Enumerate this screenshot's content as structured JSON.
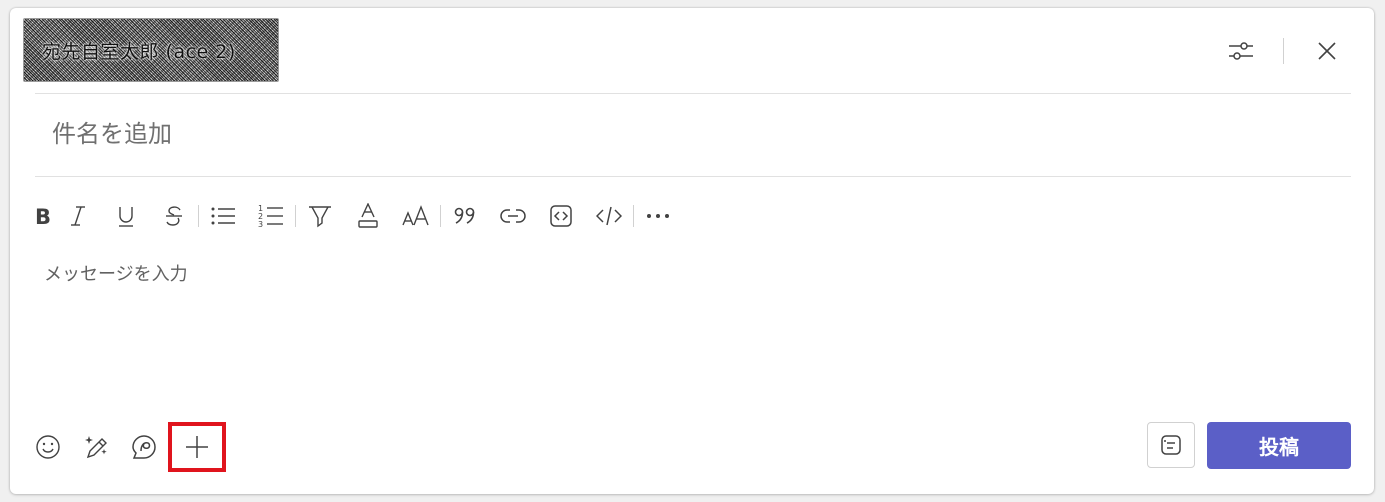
{
  "header": {
    "recipient": "宛先自室太郎 (ace 2)",
    "options_icon": "sliders-icon",
    "close_icon": "close-icon"
  },
  "subject": {
    "placeholder": "件名を追加"
  },
  "toolbar": {
    "items": [
      {
        "name": "bold",
        "icon": "bold-icon"
      },
      {
        "name": "italic",
        "icon": "italic-icon"
      },
      {
        "name": "underline",
        "icon": "underline-icon"
      },
      {
        "name": "strikethrough",
        "icon": "strikethrough-icon"
      },
      {
        "name": "bulleted-list",
        "icon": "bulleted-list-icon"
      },
      {
        "name": "numbered-list",
        "icon": "numbered-list-icon"
      },
      {
        "name": "highlight",
        "icon": "highlighter-icon"
      },
      {
        "name": "font-color",
        "icon": "font-color-icon"
      },
      {
        "name": "font-size",
        "icon": "font-size-icon"
      },
      {
        "name": "quote",
        "icon": "quote-icon"
      },
      {
        "name": "link",
        "icon": "link-icon"
      },
      {
        "name": "code-snippet",
        "icon": "code-snippet-icon"
      },
      {
        "name": "inline-code",
        "icon": "inline-code-icon"
      },
      {
        "name": "more",
        "icon": "more-icon"
      }
    ]
  },
  "message": {
    "placeholder": "メッセージを入力"
  },
  "bottom": {
    "emoji_icon": "emoji-icon",
    "copilot_icon": "sparkle-pen-icon",
    "loop_icon": "loop-icon",
    "add_icon": "plus-icon",
    "format_icon": "format-icon",
    "post_label": "投稿"
  },
  "colors": {
    "accent": "#5b5fc7",
    "highlight_box": "#e0141d"
  }
}
